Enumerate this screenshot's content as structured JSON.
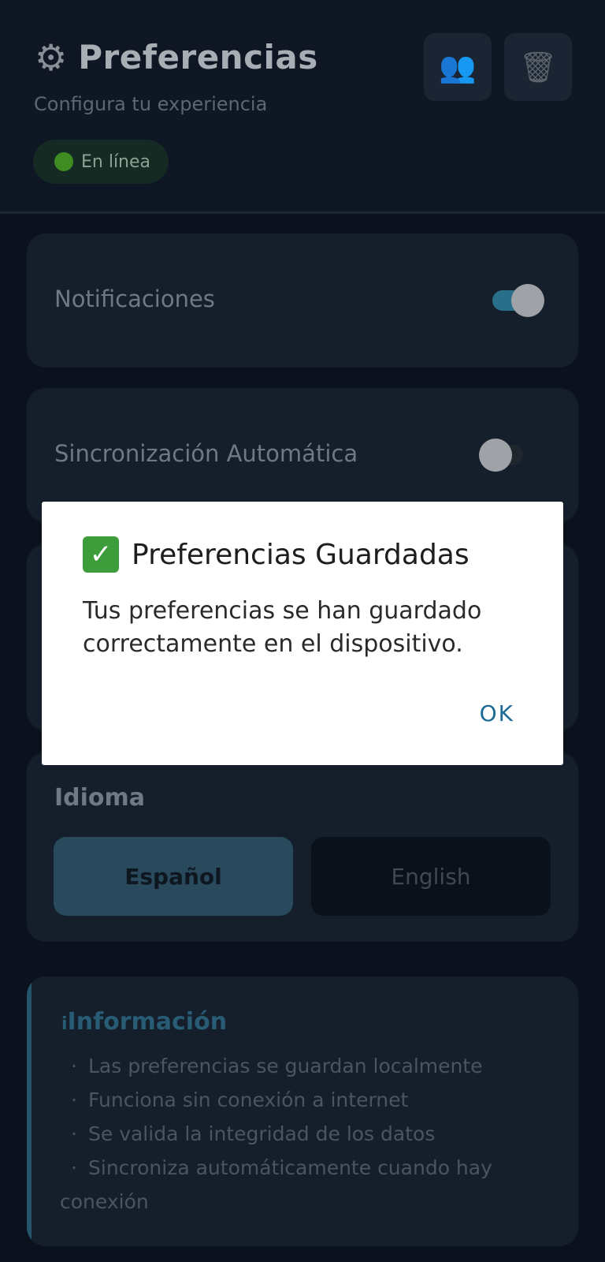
{
  "header": {
    "title": "Preferencias",
    "subtitle": "Configura tu experiencia",
    "status_label": "En línea",
    "users_icon": "👥",
    "trash_icon": "🗑"
  },
  "settings": {
    "notifications": {
      "label": "Notificaciones",
      "enabled": true
    },
    "auto_sync": {
      "label": "Sincronización Automática",
      "enabled": false
    }
  },
  "language": {
    "title": "Idioma",
    "options": [
      "Español",
      "English"
    ],
    "selected": "Español"
  },
  "info": {
    "title_icon": "i",
    "title": "Información",
    "items": [
      "Las preferencias se guardan localmente",
      "Funciona sin conexión a internet",
      "Se valida la integridad de los datos",
      "Sincroniza automáticamente cuando hay conexión"
    ]
  },
  "dialog": {
    "icon": "✓",
    "title": "Preferencias Guardadas",
    "message": "Tus preferencias se han guardado correctamente en el dispositivo.",
    "ok_label": "OK"
  },
  "colors": {
    "accent": "#24556b",
    "toggle_on": "#2a6f8a",
    "status_online": "#3f8d22"
  }
}
